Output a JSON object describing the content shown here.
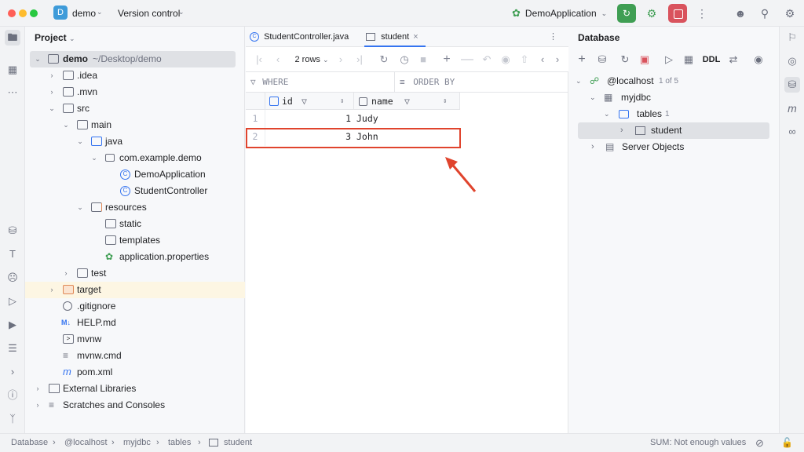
{
  "titlebar": {
    "project_badge": "D",
    "project_name": "demo",
    "version_control": "Version control",
    "run_config": "DemoApplication"
  },
  "project_panel": {
    "title": "Project",
    "root_name": "demo",
    "root_path": "~/Desktop/demo",
    "items": [
      {
        "label": ".idea"
      },
      {
        "label": ".mvn"
      },
      {
        "label": "src"
      },
      {
        "label": "main"
      },
      {
        "label": "java"
      },
      {
        "label": "com.example.demo"
      },
      {
        "label": "DemoApplication"
      },
      {
        "label": "StudentController"
      },
      {
        "label": "resources"
      },
      {
        "label": "static"
      },
      {
        "label": "templates"
      },
      {
        "label": "application.properties"
      },
      {
        "label": "test"
      },
      {
        "label": "target"
      },
      {
        "label": ".gitignore"
      },
      {
        "label": "HELP.md"
      },
      {
        "label": "mvnw"
      },
      {
        "label": "mvnw.cmd"
      },
      {
        "label": "pom.xml"
      },
      {
        "label": "External Libraries"
      },
      {
        "label": "Scratches and Consoles"
      }
    ]
  },
  "editor": {
    "tabs": [
      {
        "label": "StudentController.java"
      },
      {
        "label": "student"
      }
    ],
    "rows_label": "2 rows",
    "where_label": "WHERE",
    "order_by_label": "ORDER BY",
    "columns": [
      "id",
      "name"
    ],
    "rows": [
      {
        "num": "1",
        "id": "1",
        "name": "Judy"
      },
      {
        "num": "2",
        "id": "3",
        "name": "John"
      }
    ]
  },
  "database_panel": {
    "title": "Database",
    "ddl_label": "DDL",
    "host": "@localhost",
    "host_count": "1 of 5",
    "schema": "myjdbc",
    "tables_label": "tables",
    "tables_count": "1",
    "table": "student",
    "server_objects": "Server Objects"
  },
  "statusbar": {
    "crumbs": [
      "Database",
      "@localhost",
      "myjdbc",
      "tables",
      "student"
    ],
    "sum": "SUM: Not enough values"
  },
  "colors": {
    "accent": "#3574f0",
    "highlight_box": "#e0442d",
    "run_green": "#3f9e53",
    "stop_red": "#d9535d"
  }
}
